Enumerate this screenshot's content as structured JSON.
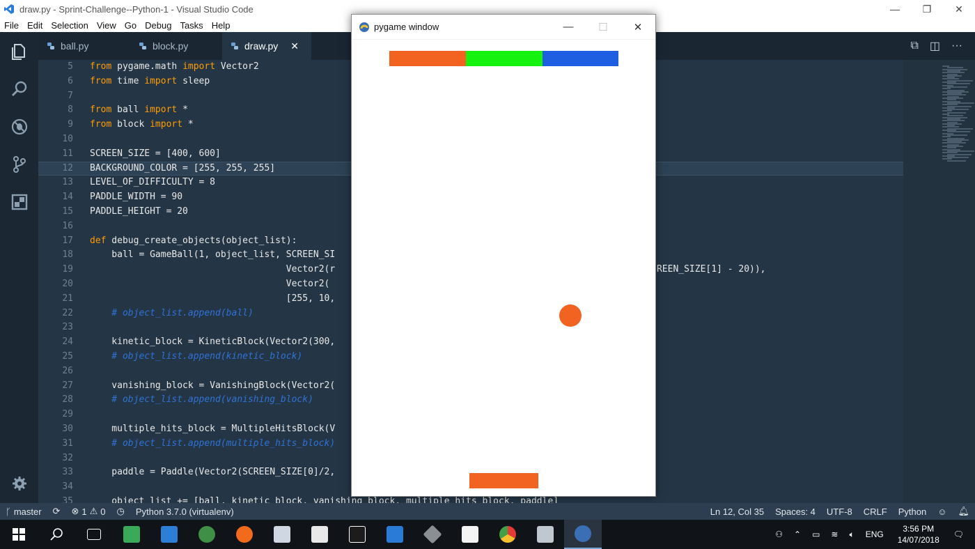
{
  "window": {
    "title": "draw.py - Sprint-Challenge--Python-1 - Visual Studio Code"
  },
  "menu": [
    "File",
    "Edit",
    "Selection",
    "View",
    "Go",
    "Debug",
    "Tasks",
    "Help"
  ],
  "tabs": [
    {
      "label": "ball.py",
      "active": false
    },
    {
      "label": "block.py",
      "active": false
    },
    {
      "label": "draw.py",
      "active": true
    }
  ],
  "editor": {
    "line_numbers": [
      "5",
      "6",
      "7",
      "8",
      "9",
      "10",
      "11",
      "12",
      "13",
      "14",
      "15",
      "16",
      "17",
      "18",
      "19",
      "20",
      "21",
      "22",
      "23",
      "24",
      "25",
      "26",
      "27",
      "28",
      "29",
      "30",
      "31",
      "32",
      "33",
      "34",
      "35"
    ],
    "highlighted_line": "12",
    "lines": [
      [
        {
          "k": "kw",
          "t": "from"
        },
        {
          "t": " pygame.math "
        },
        {
          "k": "kw",
          "t": "import"
        },
        {
          "t": " Vector2"
        }
      ],
      [
        {
          "k": "kw",
          "t": "from"
        },
        {
          "t": " time "
        },
        {
          "k": "kw",
          "t": "import"
        },
        {
          "t": " sleep"
        }
      ],
      [],
      [
        {
          "k": "kw",
          "t": "from"
        },
        {
          "t": " ball "
        },
        {
          "k": "kw",
          "t": "import"
        },
        {
          "t": " *"
        }
      ],
      [
        {
          "k": "kw",
          "t": "from"
        },
        {
          "t": " block "
        },
        {
          "k": "kw",
          "t": "import"
        },
        {
          "t": " *"
        }
      ],
      [],
      [
        {
          "t": "SCREEN_SIZE = [400, 600]"
        }
      ],
      [
        {
          "t": "BACKGROUND_COLOR = [255, 255, 255]"
        }
      ],
      [
        {
          "t": "LEVEL_OF_DIFFICULTY = 8"
        }
      ],
      [
        {
          "t": "PADDLE_WIDTH = 90"
        }
      ],
      [
        {
          "t": "PADDLE_HEIGHT = 20"
        }
      ],
      [],
      [
        {
          "k": "kw",
          "t": "def"
        },
        {
          "t": " debug_create_objects(object_list):"
        }
      ],
      [
        {
          "t": "    ball = GameBall(1, object_list, SCREEN_SI"
        }
      ],
      [
        {
          "t": "                                    Vector2(r                                                  nt(20, SCREEN_SIZE[1] - 20)),"
        }
      ],
      [
        {
          "t": "                                    Vector2("
        }
      ],
      [
        {
          "t": "                                    [255, 10,"
        }
      ],
      [
        {
          "k": "cm",
          "t": "    # object_list.append(ball)"
        }
      ],
      [],
      [
        {
          "t": "    kinetic_block = KineticBlock(Vector2(300,"
        }
      ],
      [
        {
          "k": "cm",
          "t": "    # object_list.append(kinetic_block)"
        }
      ],
      [],
      [
        {
          "t": "    vanishing_block = VanishingBlock(Vector2("
        }
      ],
      [
        {
          "k": "cm",
          "t": "    # object_list.append(vanishing_block)"
        }
      ],
      [],
      [
        {
          "t": "    multiple_hits_block = MultipleHitsBlock(V"
        }
      ],
      [
        {
          "k": "cm",
          "t": "    # object_list.append(multiple_hits_block)"
        }
      ],
      [],
      [
        {
          "t": "    paddle = Paddle(Vector2(SCREEN_SIZE[0]/2,                                              255, 165, 0])"
        }
      ],
      [],
      [
        {
          "t": "    object_list += [ball, kinetic_block, vanishing_block, multiple_hits_block, paddle]"
        }
      ]
    ]
  },
  "pygame": {
    "title": "pygame window",
    "blocks_colors": [
      "#f26322",
      "#16f10f",
      "#1e5ee0"
    ],
    "ball_color": "#f26322",
    "paddle_color": "#f26322"
  },
  "status": {
    "branch": "master",
    "errors": "1",
    "warnings": "0",
    "interpreter": "Python 3.7.0 (virtualenv)",
    "position": "Ln 12, Col 35",
    "spaces": "Spaces: 4",
    "encoding": "UTF-8",
    "eol": "CRLF",
    "language": "Python"
  },
  "taskbar": {
    "lang": "ENG",
    "time": "3:56 PM",
    "date": "14/07/2018",
    "apps": [
      "file-explorer-app",
      "task-view-app",
      "evernote-app",
      "instagram-app",
      "mongodb-app",
      "postman-app",
      "scanner-app",
      "notepad-app",
      "pycharm-app",
      "vscode-app",
      "git-app",
      "sublime-app",
      "chrome-app",
      "settings-app",
      "pygame-app"
    ]
  }
}
